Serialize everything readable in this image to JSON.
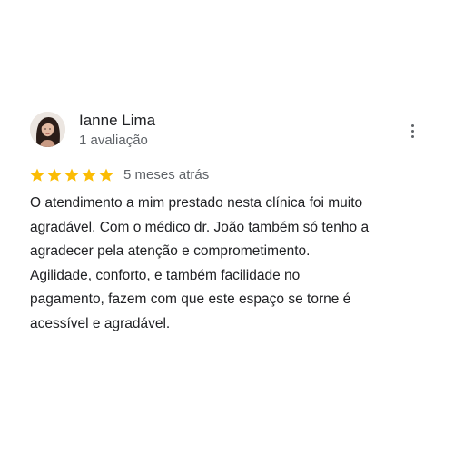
{
  "review": {
    "reviewer_name": "Ianne Lima",
    "reviewer_meta": "1 avaliação",
    "rating": 5,
    "rating_max": 5,
    "date": "5 meses atrás",
    "text_lines": [
      "O atendimento a mim prestado nesta clínica foi muito",
      "agradável. Com o médico dr. João também só tenho a",
      "agradecer pela atenção e comprometimento.",
      "Agilidade, conforto, e também facilidade no",
      "pagamento, fazem com que este espaço se torne é",
      "acessível e agradável."
    ]
  },
  "icons": {
    "star": "star-icon",
    "more": "more-vert-icon",
    "avatar": "avatar-photo"
  },
  "colors": {
    "star": "#fbbc04",
    "primary_text": "#202124",
    "secondary_text": "#5f6368",
    "background": "#ffffff"
  }
}
